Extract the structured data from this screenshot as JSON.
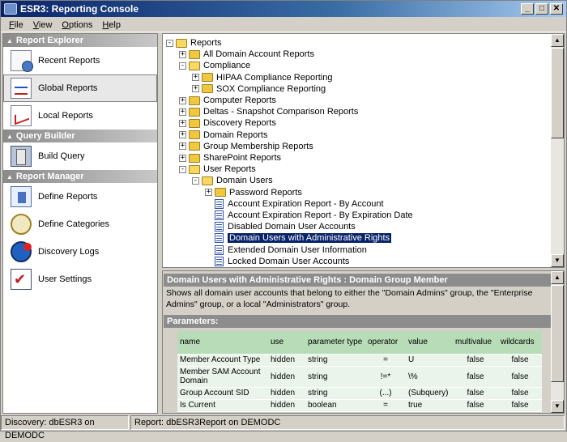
{
  "window": {
    "title": "ESR3: Reporting Console",
    "min_label": "_",
    "max_label": "□",
    "close_label": "✕"
  },
  "menu": [
    {
      "u": "F",
      "rest": "ile"
    },
    {
      "u": "V",
      "rest": "iew"
    },
    {
      "u": "O",
      "rest": "ptions"
    },
    {
      "u": "H",
      "rest": "elp"
    }
  ],
  "sidebar": {
    "sections": [
      {
        "title": "Report Explorer",
        "items": [
          {
            "label": "Recent Reports",
            "icon": "recent-reports-icon"
          },
          {
            "label": "Global Reports",
            "icon": "global-reports-icon",
            "selected": true
          },
          {
            "label": "Local Reports",
            "icon": "local-reports-icon"
          }
        ]
      },
      {
        "title": "Query Builder",
        "items": [
          {
            "label": "Build Query",
            "icon": "build-query-icon"
          }
        ]
      },
      {
        "title": "Report Manager",
        "items": [
          {
            "label": "Define Reports",
            "icon": "define-reports-icon"
          },
          {
            "label": "Define Categories",
            "icon": "define-categories-icon"
          },
          {
            "label": "Discovery Logs",
            "icon": "discovery-logs-icon"
          },
          {
            "label": "User Settings",
            "icon": "user-settings-icon"
          }
        ]
      }
    ]
  },
  "tree": {
    "nodes": [
      {
        "label": "Reports",
        "level": 0,
        "expander": "-",
        "type": "folder-open"
      },
      {
        "label": "All Domain Account Reports",
        "level": 1,
        "expander": "+",
        "type": "folder"
      },
      {
        "label": "Compliance",
        "level": 1,
        "expander": "-",
        "type": "folder-open"
      },
      {
        "label": "HIPAA Compliance Reporting",
        "level": 2,
        "expander": "+",
        "type": "folder"
      },
      {
        "label": "SOX Compliance Reporting",
        "level": 2,
        "expander": "+",
        "type": "folder"
      },
      {
        "label": "Computer Reports",
        "level": 1,
        "expander": "+",
        "type": "folder"
      },
      {
        "label": "Deltas - Snapshot Comparison Reports",
        "level": 1,
        "expander": "+",
        "type": "folder"
      },
      {
        "label": "Discovery Reports",
        "level": 1,
        "expander": "+",
        "type": "folder"
      },
      {
        "label": "Domain Reports",
        "level": 1,
        "expander": "+",
        "type": "folder"
      },
      {
        "label": "Group Membership Reports",
        "level": 1,
        "expander": "+",
        "type": "folder"
      },
      {
        "label": "SharePoint Reports",
        "level": 1,
        "expander": "+",
        "type": "folder"
      },
      {
        "label": "User Reports",
        "level": 1,
        "expander": "-",
        "type": "folder-open"
      },
      {
        "label": "Domain Users",
        "level": 2,
        "expander": "-",
        "type": "folder-open"
      },
      {
        "label": "Password Reports",
        "level": 3,
        "expander": "+",
        "type": "folder"
      },
      {
        "label": "Account Expiration Report - By Account",
        "level": 3,
        "expander": "",
        "type": "report"
      },
      {
        "label": "Account Expiration Report - By Expiration Date",
        "level": 3,
        "expander": "",
        "type": "report"
      },
      {
        "label": "Disabled Domain User Accounts",
        "level": 3,
        "expander": "",
        "type": "report"
      },
      {
        "label": "Domain Users with Administrative Rights",
        "level": 3,
        "expander": "",
        "type": "report",
        "selected": true
      },
      {
        "label": "Extended Domain User Information",
        "level": 3,
        "expander": "",
        "type": "report"
      },
      {
        "label": "Locked Domain User Accounts",
        "level": 3,
        "expander": "",
        "type": "report"
      }
    ]
  },
  "details": {
    "title": "Domain Users with Administrative Rights : Domain Group Member",
    "description": "Shows all domain user accounts that belong to either the \"Domain Admins\" group, the \"Enterprise Admins\" group, or a local \"Administrators\" group.",
    "params_label": "Parameters:",
    "columns": [
      "name",
      "use",
      "parameter type",
      "operator",
      "value",
      "multivalue",
      "wildcards"
    ],
    "rows": [
      [
        "Member Account Type",
        "hidden",
        "string",
        "=",
        "U",
        "false",
        "false"
      ],
      [
        "Member SAM Account Domain",
        "hidden",
        "string",
        "!=*",
        "\\%",
        "false",
        "false"
      ],
      [
        "Group Account SID",
        "hidden",
        "string",
        "(...)",
        "(Subquery)",
        "false",
        "false"
      ],
      [
        "Is Current",
        "hidden",
        "boolean",
        "=",
        "true",
        "false",
        "false"
      ]
    ]
  },
  "status": {
    "discovery": "Discovery: dbESR3 on DEMODC",
    "report": "Report: dbESR3Report on DEMODC"
  }
}
